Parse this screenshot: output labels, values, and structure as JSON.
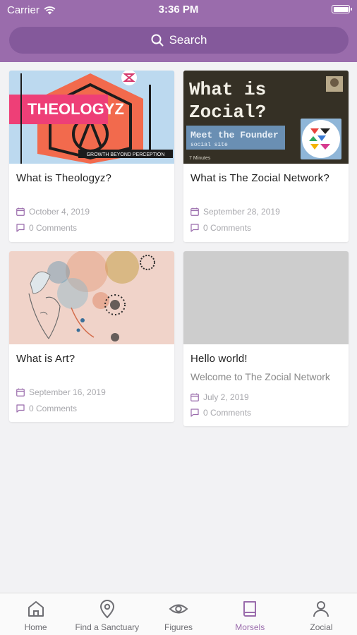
{
  "status_bar": {
    "carrier": "Carrier",
    "time": "3:36 PM"
  },
  "search": {
    "label": "Search"
  },
  "cards": [
    {
      "title": "What is Theologyz?",
      "excerpt": "",
      "date": "October 4, 2019",
      "comments": "0 Comments",
      "image": {
        "type": "theologyz",
        "banner_text": "THEOLOGYZ",
        "tagline": "GROWTH BEYOND PERCEPTION"
      }
    },
    {
      "title": "What is The Zocial Network?",
      "excerpt": "",
      "date": "September 28, 2019",
      "comments": "0 Comments",
      "image": {
        "type": "zocial",
        "headline_1": "What is",
        "headline_2": "Zocial?",
        "subline": "Meet the Founder",
        "subline_2": "social site",
        "corner_text": "7 Minutes"
      }
    },
    {
      "title": "What is Art?",
      "excerpt": "",
      "date": "September 16, 2019",
      "comments": "0 Comments",
      "image": {
        "type": "art"
      }
    },
    {
      "title": "Hello world!",
      "excerpt": "Welcome to The Zocial Network",
      "date": "July 2, 2019",
      "comments": "0 Comments",
      "image": {
        "type": "placeholder"
      }
    }
  ],
  "tabbar": {
    "items": [
      {
        "label": "Home",
        "icon": "home-icon",
        "active": false
      },
      {
        "label": "Find a Sanctuary",
        "icon": "location-pin-icon",
        "active": false
      },
      {
        "label": "Figures",
        "icon": "eye-icon",
        "active": false
      },
      {
        "label": "Morsels",
        "icon": "book-icon",
        "active": true
      },
      {
        "label": "Zocial",
        "icon": "user-icon",
        "active": false
      }
    ]
  },
  "colors": {
    "header": "#9a6cac",
    "search_bg": "#84599b",
    "accent": "#9a6cac",
    "background": "#f2f2f4"
  }
}
